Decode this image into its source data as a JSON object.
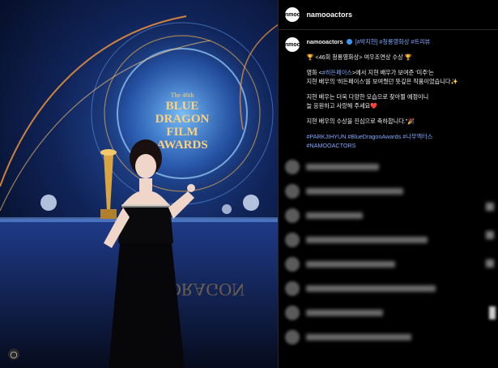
{
  "post": {
    "image_alt": "",
    "award_title": [
      "The 46th",
      "BLUE",
      "DRAGON",
      "FILM",
      "AWARDS"
    ]
  },
  "header": {
    "avatar_text": "nmoo",
    "username": "namooactors"
  },
  "caption": {
    "username": "namooactors",
    "hashtags_inline": "[#박지현] #청룡영화상 #트리뷰",
    "line1": "🏆 <46회 청룡영화상> 여우조연상 수상 🏆",
    "line2a_pre": "영화 <",
    "line2a_link": "#히든페이스",
    "line2a_post": ">에서 지현 배우가 보여준 '미주'는",
    "line2b": "지현 배우의 '히든페이스'를 보여줬던 뜻깊은 작품이었습니다✨",
    "line3a": "지현 배우는 더욱 다양한 모습으로 찾아뵐 예정이니",
    "line3b": "늘 응원하고 사랑해 주세요❤️",
    "line4": "지현 배우의 수상을 진심으로 축하합니다.”🎉",
    "hashtags1": "#PARKJIHYUN #BlueDragonAwards #나무엑터스",
    "hashtags2": "#NAMOOACTORS"
  },
  "colors": {
    "link": "#7fa8ff",
    "verified": "#3897f0",
    "background": "#000000"
  }
}
